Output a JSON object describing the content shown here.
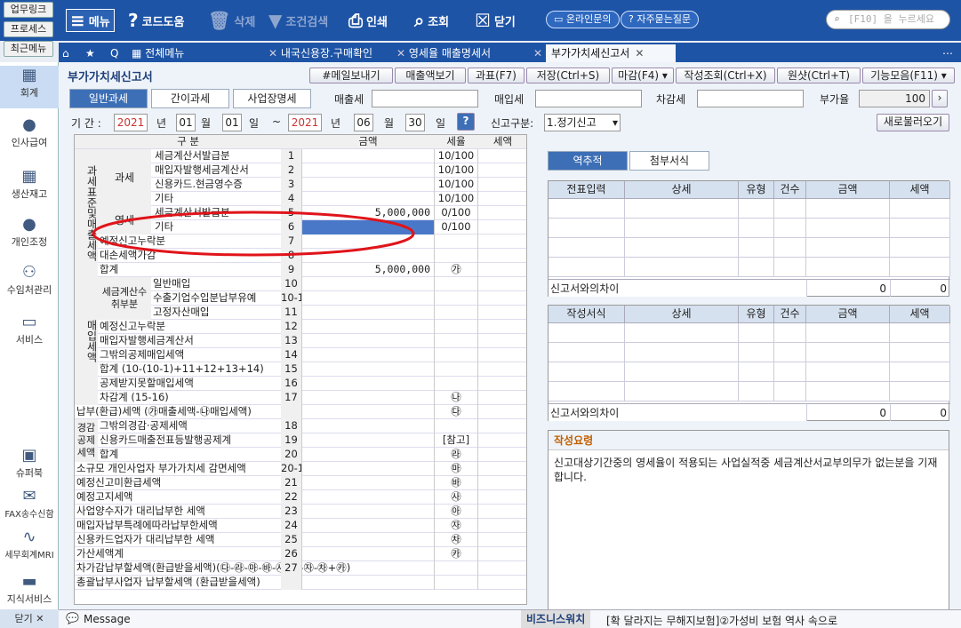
{
  "toolbar": {
    "quick": [
      "업무링크",
      "프로세스",
      "최근메뉴"
    ],
    "menu": "메뉴",
    "code_help": "코드도움",
    "delete": "삭제",
    "condition_search": "조건검색",
    "print": "인쇄",
    "lookup": "조회",
    "close": "닫기",
    "online_inquiry": "온라인문의",
    "faq": "자주묻는질문",
    "search_placeholder": "[F10] 을 누르세요"
  },
  "sidebar": {
    "items": [
      "회계",
      "인사급여",
      "생산재고",
      "개인조정",
      "수임처관리",
      "서비스",
      "슈퍼북",
      "FAX송수신함",
      "세무회계MRI",
      "지식서비스"
    ],
    "close": "닫기",
    "close_x": "✕"
  },
  "tabs": [
    "전체메뉴",
    "내국신용장.구매확인",
    "영세율 매출명세서",
    "부가가치세신고서"
  ],
  "page": {
    "title": "부가가치세신고서",
    "buttons": [
      "#메일보내기",
      "매출액보기",
      "과표(F7)",
      "저장(Ctrl+S)",
      "마감(F4)",
      "작성조회(Ctrl+X)",
      "원샷(Ctrl+T)",
      "기능모음(F11)"
    ],
    "subtabs": [
      "일반과세",
      "간이과세",
      "사업장명세"
    ],
    "sales_tax_label": "매출세",
    "purchase_tax_label": "매입세",
    "net_tax_label": "차감세",
    "vat_rate_label": "부가율",
    "vat_rate_value": "100",
    "period_label": "기 간 :",
    "year_from": "2021",
    "year_label": "년",
    "month_from": "01",
    "month_label": "월",
    "day_from": "01",
    "day_label": "일",
    "tilde": "~",
    "year_to": "2021",
    "month_to": "06",
    "day_to": "30",
    "report_type_label": "신고구분:",
    "report_type_value": "1.정기신고",
    "reload": "새로불러오기"
  },
  "form": {
    "headers": [
      "구 분",
      "금액",
      "세율",
      "세액"
    ],
    "groups": {
      "sales": "과세표준및매출세액",
      "purchase": "매입세액",
      "taxable": "과세",
      "zero": "영세",
      "receipt": "세금계산수취부분",
      "deduction": "경감공제세액"
    },
    "rows": [
      {
        "label": "세금계산서발급분",
        "no": "1",
        "amount": "",
        "rate": "10/100"
      },
      {
        "label": "매입자발행세금계산서",
        "no": "2",
        "amount": "",
        "rate": "10/100"
      },
      {
        "label": "신용카드.현금영수증",
        "no": "3",
        "amount": "",
        "rate": "10/100"
      },
      {
        "label": "기타",
        "no": "4",
        "amount": "",
        "rate": "10/100"
      },
      {
        "label": "세금계산서발급분",
        "no": "5",
        "amount": "5,000,000",
        "rate": "0/100"
      },
      {
        "label": "기타",
        "no": "6",
        "amount": "",
        "rate": "0/100"
      },
      {
        "label": "예정신고누락분",
        "no": "7",
        "amount": "",
        "rate": ""
      },
      {
        "label": "대손세액가감",
        "no": "8",
        "amount": "",
        "rate": ""
      },
      {
        "label": "합계",
        "no": "9",
        "amount": "5,000,000",
        "rate": "㉮"
      },
      {
        "label": "일반매입",
        "no": "10",
        "amount": "",
        "rate": ""
      },
      {
        "label": "수출기업수입분납부유예",
        "no": "10-1",
        "amount": "",
        "rate": ""
      },
      {
        "label": "고정자산매입",
        "no": "11",
        "amount": "",
        "rate": ""
      },
      {
        "label": "예정신고누락분",
        "no": "12",
        "amount": "",
        "rate": ""
      },
      {
        "label": "매입자발행세금계산서",
        "no": "13",
        "amount": "",
        "rate": ""
      },
      {
        "label": "그밖의공제매입세액",
        "no": "14",
        "amount": "",
        "rate": ""
      },
      {
        "label": "합계 (10-(10-1)+11+12+13+14)",
        "no": "15",
        "amount": "",
        "rate": ""
      },
      {
        "label": "공제받지못할매입세액",
        "no": "16",
        "amount": "",
        "rate": ""
      },
      {
        "label": "차감계 (15-16)",
        "no": "17",
        "amount": "",
        "rate": "㉯"
      },
      {
        "label": "납부(환급)세액 (㉮매출세액-㉯매입세액)",
        "no": "",
        "amount": "",
        "rate": "㉰"
      },
      {
        "label": "그밖의경감·공제세액",
        "no": "18",
        "amount": "",
        "rate": ""
      },
      {
        "label": "신용카드매출전표등발행공제계",
        "no": "19",
        "amount": "",
        "rate": "[참고]"
      },
      {
        "label": "합계",
        "no": "20",
        "amount": "",
        "rate": "㉱"
      },
      {
        "label": "소규모 개인사업자 부가가치세 감면세액",
        "no": "20-1",
        "amount": "",
        "rate": "㉲"
      },
      {
        "label": "예정신고미환급세액",
        "no": "21",
        "amount": "",
        "rate": "㉳"
      },
      {
        "label": "예정고지세액",
        "no": "22",
        "amount": "",
        "rate": "㉴"
      },
      {
        "label": "사업양수자가 대리납부한 세액",
        "no": "23",
        "amount": "",
        "rate": "㉵"
      },
      {
        "label": "매입자납부특례에따라납부한세액",
        "no": "24",
        "amount": "",
        "rate": "㉶"
      },
      {
        "label": "신용카드업자가 대리납부한 세액",
        "no": "25",
        "amount": "",
        "rate": "㉷"
      },
      {
        "label": "가산세액계",
        "no": "26",
        "amount": "",
        "rate": "㉸"
      },
      {
        "label": "차가감납부할세액(환급받을세액)(㉰-㉱-㉲-㉳-㉴-㉵-㉶-㉷+㉸)",
        "no": "27",
        "amount": "",
        "rate": ""
      },
      {
        "label": "총괄납부사업자 납부할세액 (환급받을세액)",
        "no": "",
        "amount": "",
        "rate": ""
      }
    ]
  },
  "right": {
    "tabs": [
      "역추적",
      "첨부서식"
    ],
    "grid1_headers": [
      "전표입력",
      "상세",
      "유형",
      "건수",
      "금액",
      "세액"
    ],
    "grid2_headers": [
      "작성서식",
      "상세",
      "유형",
      "건수",
      "금액",
      "세액"
    ],
    "diff_label": "신고서와의차이",
    "diff_amount": "0",
    "diff_tax": "0",
    "guide_title": "작성요령",
    "guide_text": "신고대상기간중의 영세율이 적용되는 사업실적중 세금계산서교부의무가 없는분을 기재합니다."
  },
  "footer": {
    "message": "Message",
    "biz_watch": "비즈니스워치",
    "ticker": "[확 달라지는 무해지보험]②가성비 보험 역사 속으로"
  },
  "colors": {
    "toolbar": "#1e54a6",
    "annotation": "#e0141a",
    "selected_cell": "#4a78c8"
  }
}
